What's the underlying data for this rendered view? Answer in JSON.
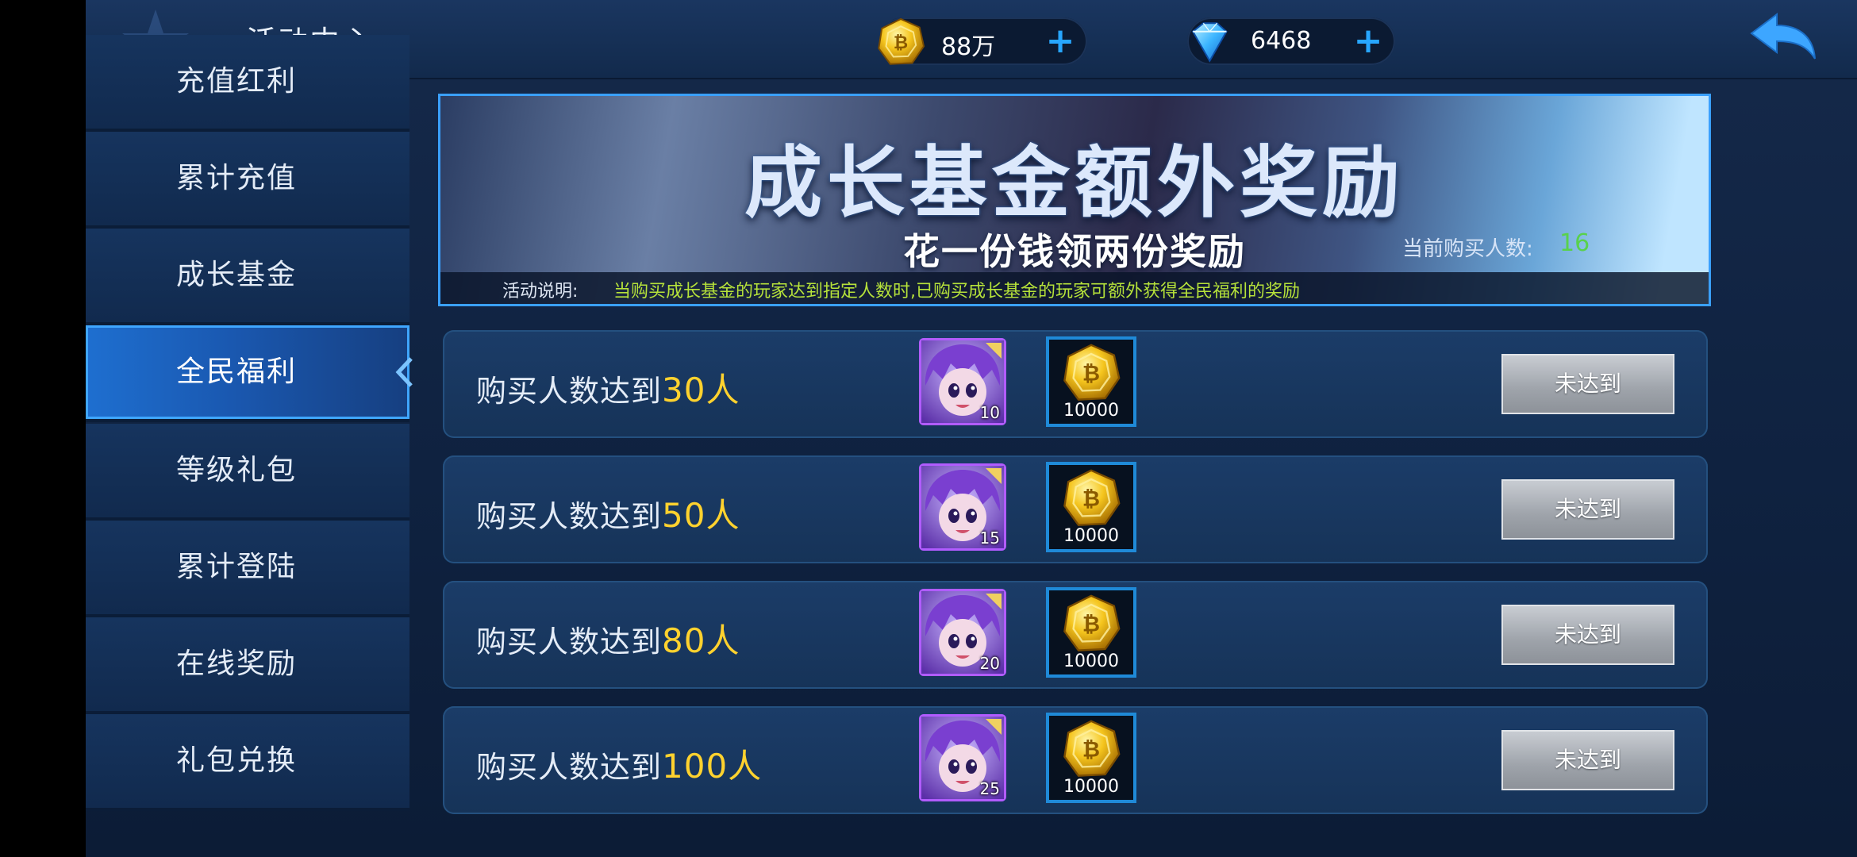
{
  "header": {
    "title": "活动中心",
    "gold": "88万",
    "diamond": "6468",
    "gold_icon": "gold-coin-icon",
    "diamond_icon": "diamond-icon",
    "back_icon": "back-arrow-icon"
  },
  "sidebar": {
    "items": [
      {
        "label": "充值红利"
      },
      {
        "label": "累计充值"
      },
      {
        "label": "成长基金"
      },
      {
        "label": "全民福利",
        "active": true
      },
      {
        "label": "等级礼包"
      },
      {
        "label": "累计登陆"
      },
      {
        "label": "在线奖励"
      },
      {
        "label": "礼包兑换"
      }
    ]
  },
  "banner": {
    "main": "成长基金额外奖励",
    "sub": "花一份钱领两份奖励",
    "count_label": "当前购买人数:",
    "count_value": "16",
    "desc_label": "活动说明:",
    "desc_text": "当购买成长基金的玩家达到指定人数时,已购买成长基金的玩家可额外获得全民福利的奖励"
  },
  "rewards": [
    {
      "prefix": "购买人数达到",
      "num": "30人",
      "hero_qty": "10",
      "coin_qty": "10000",
      "status": "未达到"
    },
    {
      "prefix": "购买人数达到",
      "num": "50人",
      "hero_qty": "15",
      "coin_qty": "10000",
      "status": "未达到"
    },
    {
      "prefix": "购买人数达到",
      "num": "80人",
      "hero_qty": "20",
      "coin_qty": "10000",
      "status": "未达到"
    },
    {
      "prefix": "购买人数达到",
      "num": "100人",
      "hero_qty": "25",
      "coin_qty": "10000",
      "status": "未达到"
    }
  ],
  "colors": {
    "accent_blue": "#3aa0ff",
    "highlight_yellow": "#ffd22e",
    "desc_green": "#b6e23a",
    "count_green": "#59d14c"
  }
}
